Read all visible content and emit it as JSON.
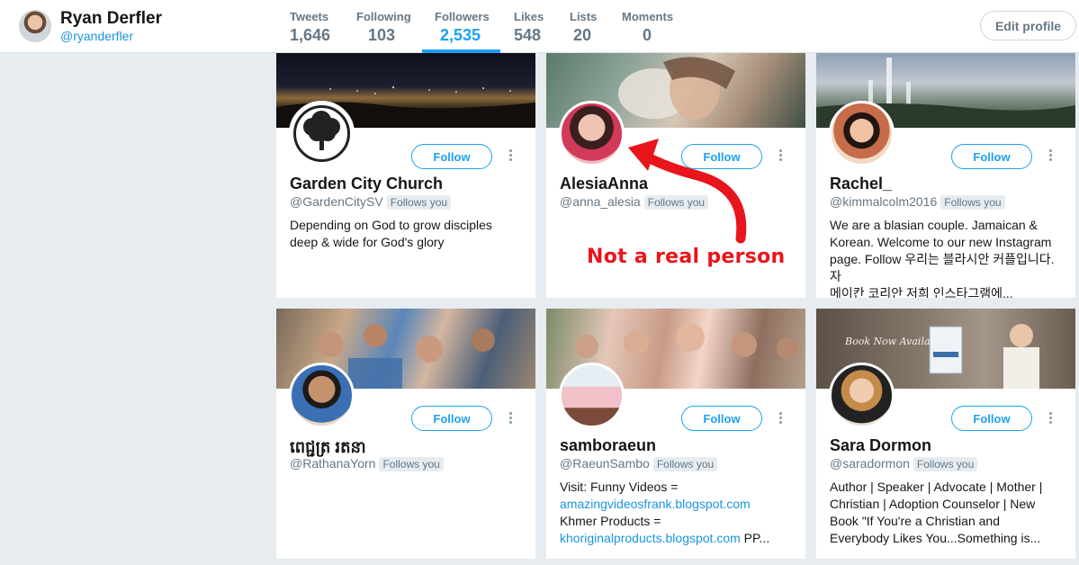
{
  "profile": {
    "name": "Ryan Derfler",
    "handle": "@ryanderfler",
    "edit_label": "Edit profile"
  },
  "stats": [
    {
      "label": "Tweets",
      "value": "1,646"
    },
    {
      "label": "Following",
      "value": "103"
    },
    {
      "label": "Followers",
      "value": "2,535"
    },
    {
      "label": "Likes",
      "value": "548"
    },
    {
      "label": "Lists",
      "value": "20"
    },
    {
      "label": "Moments",
      "value": "0"
    }
  ],
  "active_tab": "Followers",
  "colors": {
    "accent": "#1da1f2",
    "annotation": "#e8151c",
    "background": "#e6ecf0"
  },
  "cards": [
    {
      "name": "Garden City Church",
      "handle": "@GardenCitySV",
      "follows_you": "Follows you",
      "follow": "Follow",
      "bio": [
        "Depending on God to grow disciples",
        "deep & wide for God's glory"
      ]
    },
    {
      "name": "AlesiaAnna",
      "handle": "@anna_alesia",
      "follows_you": "Follows you",
      "follow": "Follow",
      "bio": []
    },
    {
      "name": "Rachel_",
      "handle": "@kimmalcolm2016",
      "follows_you": "Follows you",
      "follow": "Follow",
      "bio": [
        "We are a blasian couple. Jamaican &",
        "Korean. Welcome to our new Instagram",
        "page. Follow 우리는 블라시안 커플입니다. 자",
        "메이칸 코리안 저희 인스타그램에..."
      ]
    },
    {
      "name": "ពេជ្ជត្រ រតនា",
      "handle": "@RathanaYorn",
      "follows_you": "Follows you",
      "follow": "Follow",
      "bio": []
    },
    {
      "name": "samboraeun",
      "handle": "@RaeunSambo",
      "follows_you": "Follows you",
      "follow": "Follow",
      "bio_parts": {
        "line1": "Visit: Funny Videos =",
        "link1": "amazingvideosfrank.blogspot.com",
        "line3": "Khmer Products =",
        "link2": "khoriginalproducts.blogspot.com",
        "tail": " PP..."
      }
    },
    {
      "name": "Sara Dormon",
      "handle": "@saradormon",
      "follows_you": "Follows you",
      "follow": "Follow",
      "bio": [
        "Author | Speaker | Advocate | Mother |",
        "Christian | Adoption Counselor | New",
        "Book \"If You're a Christian and",
        "Everybody Likes You...Something is..."
      ]
    }
  ],
  "annotation": {
    "text": "Not a real person"
  },
  "banner_texts": {
    "sara": "Book Now Available"
  }
}
